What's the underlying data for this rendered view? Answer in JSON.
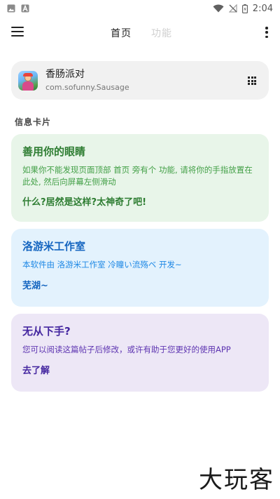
{
  "status_bar": {
    "time": "2:04",
    "icons": [
      "image-icon",
      "font-icon",
      "wifi-icon",
      "no-signal-icon",
      "battery-icon"
    ]
  },
  "app_bar": {
    "tabs": [
      {
        "label": "首页",
        "active": true
      },
      {
        "label": "功能",
        "active": false
      }
    ],
    "icons": [
      "menu-icon",
      "more-vert-icon"
    ]
  },
  "app_selector": {
    "name": "香肠派对",
    "package": "com.sofunny.Sausage",
    "icon": "app-grid-icon"
  },
  "section_title": "信息卡片",
  "cards": [
    {
      "title": "善用你的眼睛",
      "body": "如果你不能发现页面顶部 首页 旁有个 功能, 请将你的手指放置在此处, 然后向屏幕左侧滑动",
      "link": "什么?居然是这样?太神奇了吧!",
      "color": "#2e7d32",
      "bg": "#e8f5e9"
    },
    {
      "title": "洛游米工作室",
      "body": "本软件由 洛游米工作室 冷瞳い流殇ベ 开发~",
      "link": "芜湖~",
      "color": "#1565c0",
      "bg": "#e3f2fd"
    },
    {
      "title": "无从下手?",
      "body": "您可以阅读这篇帖子后修改，或许有助于您更好的使用APP",
      "link": "去了解",
      "color": "#4527a0",
      "bg": "#ede7f6"
    }
  ],
  "watermark": "大玩客"
}
